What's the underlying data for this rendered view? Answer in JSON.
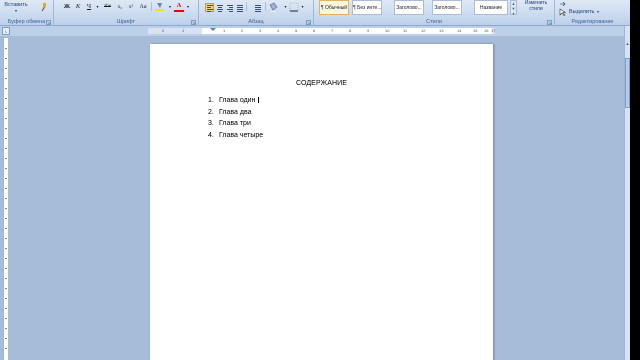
{
  "ribbon": {
    "clipboard": {
      "paste_label": "Вставить",
      "group_label": "Буфер обмена"
    },
    "font": {
      "group_label": "Шрифт",
      "buttons": [
        "Ж",
        "К",
        "Ч",
        "abe",
        "x₂",
        "x²",
        "Aa",
        "A"
      ]
    },
    "paragraph": {
      "group_label": "Абзац"
    },
    "styles": {
      "group_label": "Стили",
      "items": [
        "¶ Обычный",
        "¶ Без инте...",
        "Заголово...",
        "Заголово...",
        "Название"
      ],
      "selected_index": 0,
      "change_styles": "Изменить стили"
    },
    "editing": {
      "group_label": "Редактирование",
      "select_label": "Выделить"
    }
  },
  "ruler": {
    "ticks": [
      "2",
      "1",
      "1",
      "2",
      "3",
      "4",
      "5",
      "6",
      "7",
      "8",
      "9",
      "10",
      "11",
      "12",
      "13",
      "14",
      "15",
      "16",
      "17"
    ]
  },
  "document": {
    "title": "СОДЕРЖАНИЕ",
    "items": [
      {
        "num": "1.",
        "text": "Глава один"
      },
      {
        "num": "2.",
        "text": "Глава два"
      },
      {
        "num": "3.",
        "text": "Глава три"
      },
      {
        "num": "4.",
        "text": "Глава четыре"
      }
    ]
  }
}
